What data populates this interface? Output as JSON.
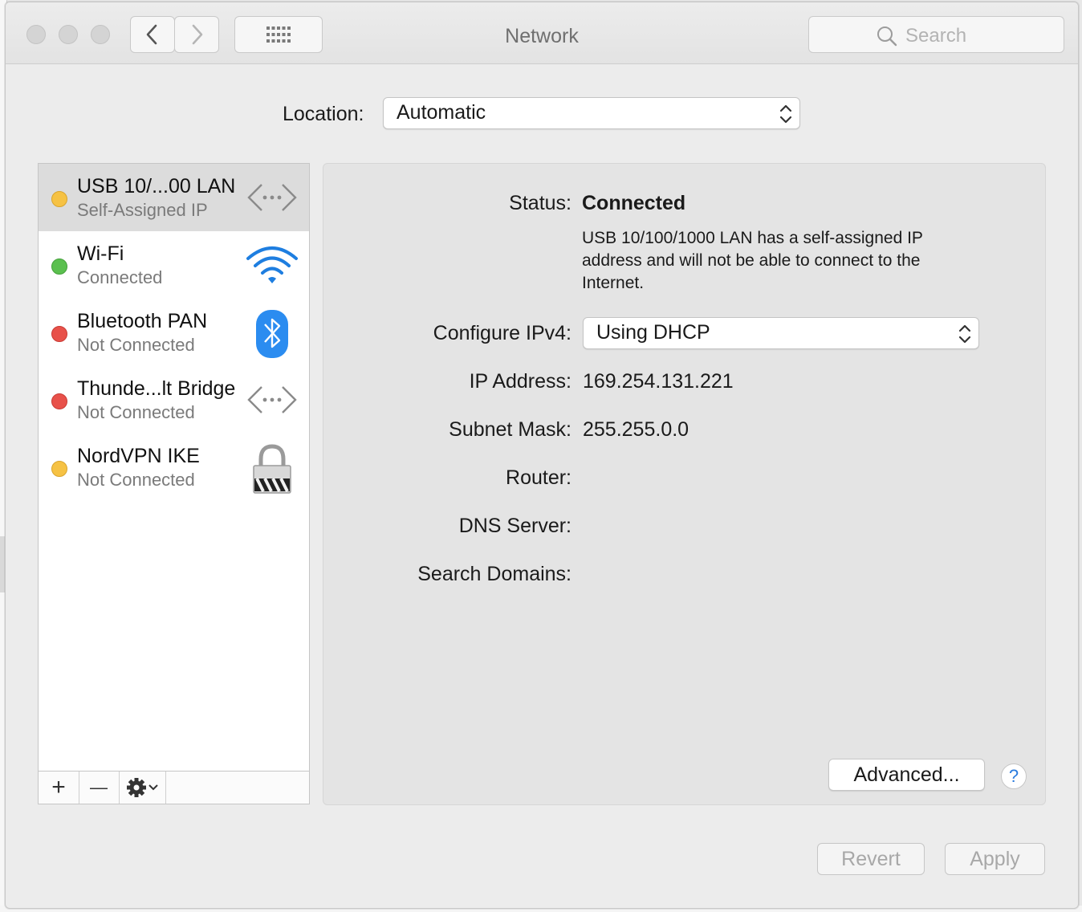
{
  "window": {
    "title": "Network",
    "search_placeholder": "Search"
  },
  "location": {
    "label": "Location:",
    "value": "Automatic"
  },
  "services": [
    {
      "name": "USB 10/...00 LAN",
      "status": "Self-Assigned IP",
      "dot_color": "#f6c244",
      "icon": "ethernet-icon",
      "selected": true
    },
    {
      "name": "Wi-Fi",
      "status": "Connected",
      "dot_color": "#5bc04f",
      "icon": "wifi-icon",
      "selected": false
    },
    {
      "name": "Bluetooth PAN",
      "status": "Not Connected",
      "dot_color": "#e8514a",
      "icon": "bluetooth-icon",
      "selected": false
    },
    {
      "name": "Thunde...lt Bridge",
      "status": "Not Connected",
      "dot_color": "#e8514a",
      "icon": "ethernet-icon",
      "selected": false
    },
    {
      "name": "NordVPN IKE",
      "status": "Not Connected",
      "dot_color": "#f6c244",
      "icon": "vpn-lock-icon",
      "selected": false
    }
  ],
  "list_toolbar": {
    "add": "+",
    "remove": "—"
  },
  "detail": {
    "status_label": "Status:",
    "status_value": "Connected",
    "status_description": "USB 10/100/1000 LAN has a self-assigned IP address and will not be able to connect to the Internet.",
    "configure_label": "Configure IPv4:",
    "configure_value": "Using DHCP",
    "ip_label": "IP Address:",
    "ip_value": "169.254.131.221",
    "subnet_label": "Subnet Mask:",
    "subnet_value": "255.255.0.0",
    "router_label": "Router:",
    "router_value": "",
    "dns_label": "DNS Server:",
    "dns_value": "",
    "search_domains_label": "Search Domains:",
    "search_domains_value": "",
    "advanced_label": "Advanced...",
    "help_label": "?"
  },
  "footer": {
    "revert_label": "Revert",
    "apply_label": "Apply"
  }
}
